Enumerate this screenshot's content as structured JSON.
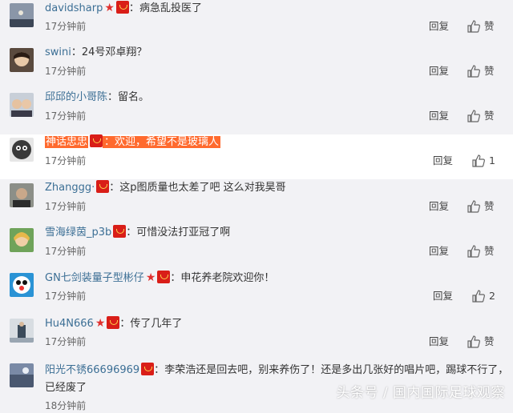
{
  "reply_label": "回复",
  "like_label": "赞",
  "comments": [
    {
      "username": "davidsharp",
      "text": "病急乱投医了",
      "time": "17分钟前",
      "likes": "",
      "star": true,
      "badge": true
    },
    {
      "username": "swini",
      "text": "24号邓卓翔？",
      "time": "17分钟前",
      "likes": "",
      "star": false,
      "badge": false
    },
    {
      "username": "邱邱的小哥陈",
      "text": "留名。",
      "time": "17分钟前",
      "likes": "",
      "star": false,
      "badge": false
    },
    {
      "username": "神话忠忠",
      "text": "欢迎，希望不是玻璃人",
      "time": "17分钟前",
      "likes": "1",
      "star": false,
      "badge": true
    },
    {
      "username": "Zhanggg·",
      "text": "这p图质量也太差了吧 这么对我昊哥",
      "time": "17分钟前",
      "likes": "",
      "star": false,
      "badge": true
    },
    {
      "username": "雪海绿茵_p3b",
      "text": "可惜没法打亚冠了啊",
      "time": "17分钟前",
      "likes": "",
      "star": false,
      "badge": true
    },
    {
      "username": "GN七剑装量子型彬仔",
      "text": "申花养老院欢迎你！",
      "time": "17分钟前",
      "likes": "2",
      "star": true,
      "badge": true
    },
    {
      "username": "Hu4N666",
      "text": "传了几年了",
      "time": "17分钟前",
      "likes": "",
      "star": true,
      "badge": true
    },
    {
      "username": "阳光不锈66696969",
      "text": "李荣浩还是回去吧，别来养伤了！还是多出几张好的唱片吧，踢球不行了，已经废了",
      "time": "18分钟前",
      "likes": "",
      "star": false,
      "badge": true
    }
  ],
  "watermark": "头条号 / 国内国际足球观察",
  "colors": {
    "link": "#3c6f95",
    "highlight": "#ff6a2e",
    "badge": "#d91e18"
  }
}
